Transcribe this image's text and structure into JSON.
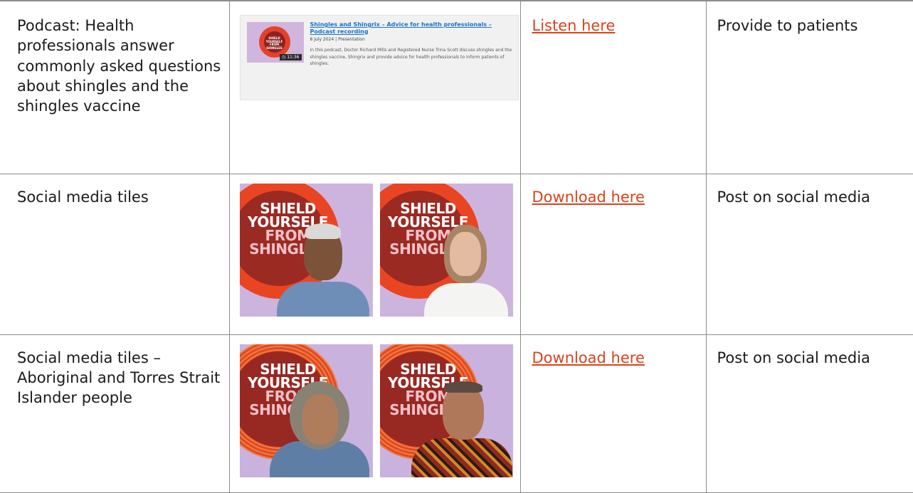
{
  "rows": [
    {
      "description": "Podcast: Health professionals answer commonly asked questions about shingles and the shingles vaccine",
      "link": "Listen here",
      "action": "Provide to patients",
      "podcast_card": {
        "title": "Shingles and Shingrix – Advice for health professionals – Podcast recording",
        "date": "8 July 2024",
        "type": "Presentation",
        "description": "In this podcast, Doctor Richard Mills and Registered Nurse Trina Scott discuss shingles and the shingles vaccine, Shingrix and provide advice for health professionals to inform patients of shingles.",
        "duration": "11:36",
        "thumb_text": "SHIELD YOURSELF FROM SHINGLES"
      }
    },
    {
      "description": "Social media tiles",
      "link": "Download here",
      "action": "Post on social media",
      "tiles": [
        {
          "line1": "SHIELD",
          "line2": "YOURSELF",
          "line3": "FROM",
          "line4": "SHINGLES"
        },
        {
          "line1": "SHIELD",
          "line2": "YOURSELF",
          "line3": "FROM",
          "line4": "SHINGLES"
        }
      ]
    },
    {
      "description": "Social media tiles – Aboriginal and Torres Strait Islander people",
      "link": "Download here",
      "action": "Post on social media",
      "tiles": [
        {
          "line1": "SHIELD",
          "line2": "YOURSELF",
          "line3": "FROM",
          "line4": "SHINGLES"
        },
        {
          "line1": "SHIELD",
          "line2": "YOURSELF",
          "line3": "FROM",
          "line4": "SHINGLES"
        }
      ]
    }
  ],
  "colors": {
    "link": "#d8431e",
    "border": "#8c8c8c",
    "tile_background": "#cdb4df",
    "tile_circle": "#ea4523",
    "tile_dark_circle": "#9b2a22"
  }
}
